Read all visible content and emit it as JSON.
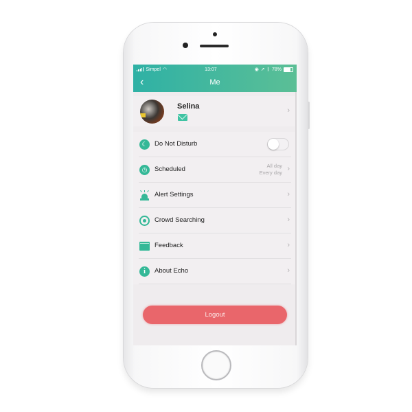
{
  "status_bar": {
    "carrier": "Simpel",
    "time": "13:07",
    "battery": "78%"
  },
  "nav": {
    "back_icon": "chevron-left-icon",
    "title": "Me"
  },
  "profile": {
    "name": "Selina",
    "mail_icon": "envelope-icon",
    "chevron": "›"
  },
  "menu": {
    "items": [
      {
        "label": "Do Not Disturb",
        "icon": "moon-icon",
        "toggle_on": false
      },
      {
        "label": "Scheduled",
        "icon": "clock-icon",
        "value_line1": "All day",
        "value_line2": "Every day"
      },
      {
        "label": "Alert Settings",
        "icon": "alarm-light-icon"
      },
      {
        "label": "Crowd Searching",
        "icon": "target-icon"
      },
      {
        "label": "Feedback",
        "icon": "feedback-box-icon"
      },
      {
        "label": "About Echo",
        "icon": "info-icon"
      }
    ],
    "chevron": "›"
  },
  "logout": {
    "label": "Logout",
    "color": "#e9666b"
  },
  "colors": {
    "header_start": "#2fb1a5",
    "header_end": "#5bbf96",
    "icon_green": "#34b897"
  }
}
